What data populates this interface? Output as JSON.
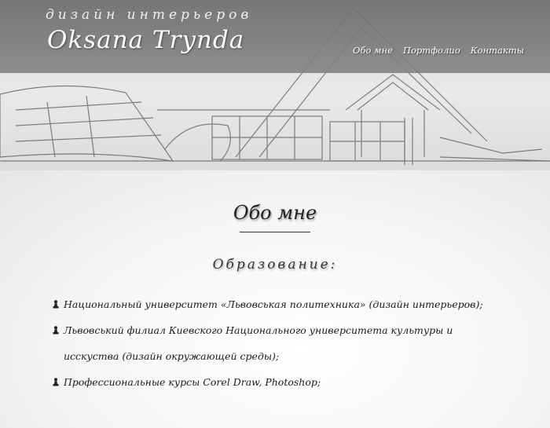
{
  "header": {
    "logo_subtitle": "дизайн интерьеров",
    "logo_title": "Oksana Trynda",
    "nav": [
      "Обо мне",
      "Портфолио",
      "Контакты"
    ]
  },
  "main": {
    "page_title": "Обо мне",
    "section_heading": "Образование:",
    "items": [
      "Национальный университет «Львовськая политехника» (дизайн интерьеров);",
      "Львовський филиал Киевского Национального университета культуры и исскуства (дизайн окружающей среды);",
      "Профессиональные курсы Corel Draw, Photoshop;"
    ]
  },
  "colors": {
    "header_band": "#767676",
    "text": "#1a1a1a",
    "header_text": "#ffffff"
  },
  "icons": {
    "list_bullet": "chess-pawn-icon"
  }
}
